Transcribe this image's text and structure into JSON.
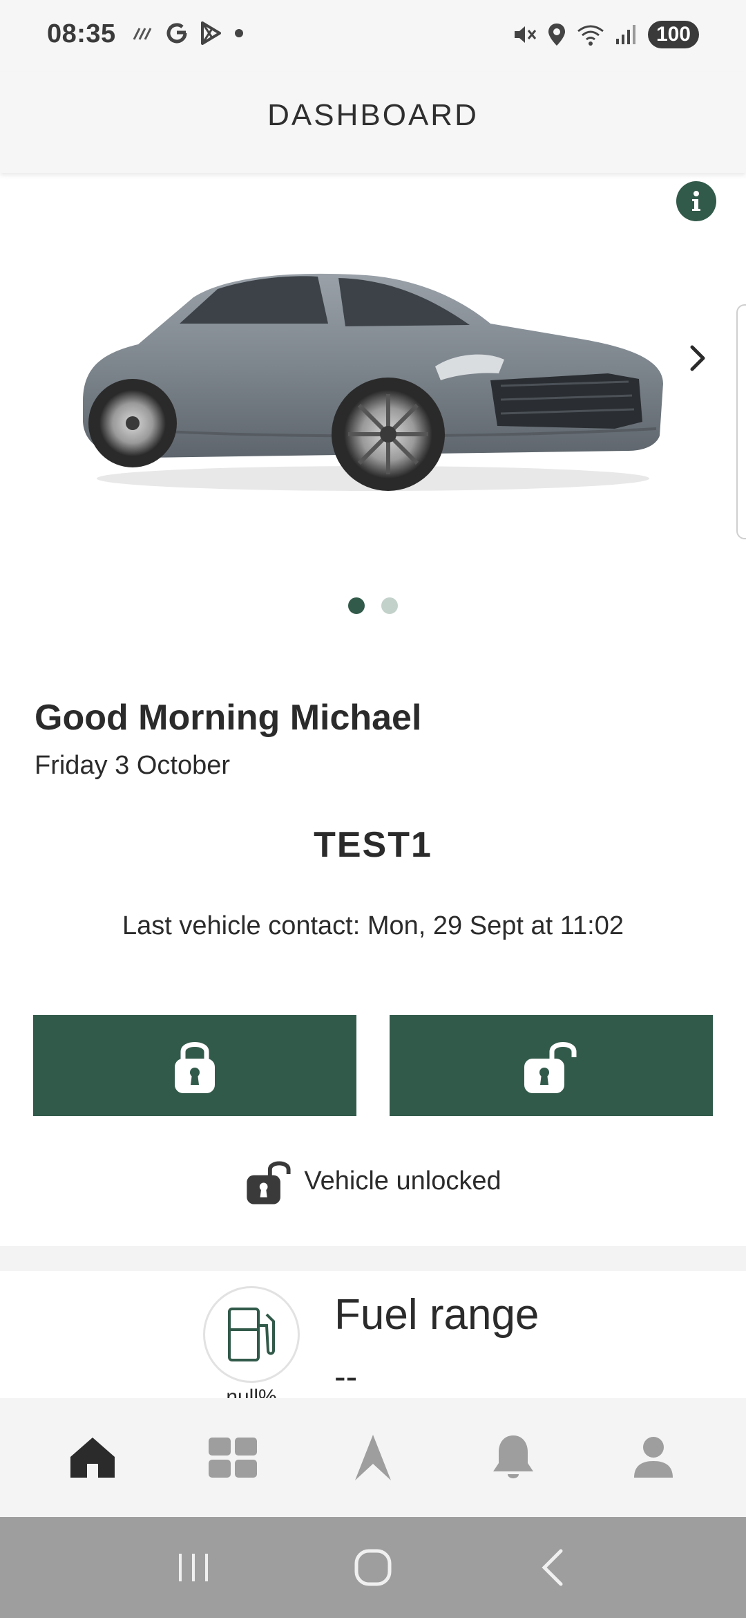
{
  "status_bar": {
    "time": "08:35",
    "battery": "100",
    "left_icons": [
      "signal-lines-icon",
      "google-icon",
      "play-store-icon",
      "dot-icon"
    ],
    "right_icons": [
      "mute-icon",
      "location-icon",
      "wifi-icon",
      "signal-icon"
    ]
  },
  "header": {
    "title": "DASHBOARD"
  },
  "hero": {
    "image": "car-image",
    "pager": {
      "count": 2,
      "active": 0
    }
  },
  "greeting": {
    "text": "Good Morning Michael",
    "date": "Friday 3 October"
  },
  "vehicle": {
    "name": "TEST1",
    "last_contact": "Last vehicle contact: Mon, 29 Sept at 11:02",
    "lock_status": "Vehicle unlocked"
  },
  "actions": {
    "lock_icon": "lock-icon",
    "unlock_icon": "unlock-icon"
  },
  "fuel": {
    "title": "Fuel range",
    "value": "--",
    "percent": "null%"
  },
  "bottom_nav": [
    "home",
    "dashboard-grid",
    "navigation",
    "notifications",
    "profile"
  ],
  "colors": {
    "accent": "#325a4a",
    "accent_light": "#c3d1cb",
    "header_bg": "#f6f6f6",
    "nav_bg": "#f4f4f4",
    "system_nav_bg": "#9e9e9e",
    "text": "#2b2b2b"
  }
}
